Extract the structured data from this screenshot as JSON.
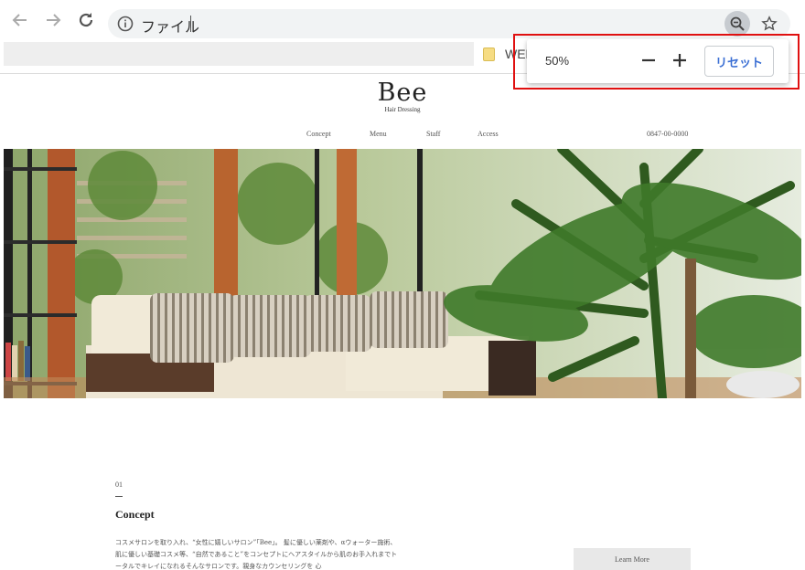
{
  "browser": {
    "address_bar": {
      "scheme_label": "ファイル",
      "url": ""
    },
    "bookmarks": [
      {
        "label": "WEB"
      }
    ],
    "zoom_popup": {
      "level": "50%",
      "decrease": "−",
      "increase": "+",
      "reset_label": "リセット"
    }
  },
  "site": {
    "logo": {
      "title": "Bee",
      "subtitle": "Hair Dressing"
    },
    "nav": [
      "Concept",
      "Menu",
      "Staff",
      "Access"
    ],
    "phone": "0847-00-0000",
    "section": {
      "number": "01",
      "title": "Concept",
      "body": "コスメサロンを取り入れ、“女性に嬉しいサロン”「Bee」。 髪に優しい薬剤や、αウォーター施術、肌に優しい基礎コスメ等、“自然であること”をコンセプトにヘアスタイルから肌のお手入れまでトータルでキレイになれるそんなサロンです。親身なカウンセリングを 心"
    },
    "learn_more": "Learn More"
  }
}
